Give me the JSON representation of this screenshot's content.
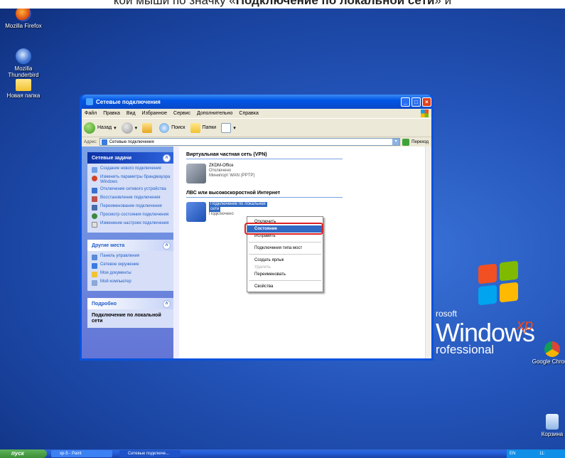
{
  "caption": {
    "before": "кой мыши по значку «",
    "bold": "Подключение по локальной сети",
    "after": "» и"
  },
  "desktop_icons": {
    "firefox": "Mozilla Firefox",
    "thunderbird": "Mozilla Thunderbird",
    "new_folder": "Новая папка",
    "chrome": "Google Chrome",
    "recycle_bin": "Корзина"
  },
  "logo": {
    "microsoft": "rosoft",
    "windows": "Windows",
    "xp": "xp",
    "professional": "rofessional"
  },
  "window": {
    "title": "Сетевые подключения",
    "menu": [
      "Файл",
      "Правка",
      "Вид",
      "Избранное",
      "Сервис",
      "Дополнительно",
      "Справка"
    ],
    "toolbar": {
      "back": "Назад",
      "search": "Поиск",
      "folders": "Папки"
    },
    "address": {
      "label": "Адрес:",
      "value": "Сетевые подключения",
      "go": "Переход"
    }
  },
  "left_pane": {
    "network_tasks": {
      "title": "Сетевые задачи",
      "items": [
        "Создание нового подключения",
        "Изменить параметры брандмауэра Windows",
        "Отключение сетевого устройства",
        "Восстановление подключения",
        "Переименование подключения",
        "Просмотр состояния подключения",
        "Изменение настроек подключения"
      ]
    },
    "other_places": {
      "title": "Другие места",
      "items": [
        "Панель управления",
        "Сетевое окружение",
        "Мои документы",
        "Мой компьютер"
      ]
    },
    "details": {
      "title": "Подробно",
      "text": "Подключение по локальной сети"
    }
  },
  "main_pane": {
    "vpn_group": "Виртуальная частная сеть (VPN)",
    "vpn_conn": {
      "name": "ZKDM-Office",
      "status": "Отключено",
      "device": "Минипорт WAN (PPTP)"
    },
    "lan_group": "ЛВС или высокоскоростной Интернет",
    "lan_conn": {
      "name_line1": "Подключение по локальной",
      "name_line2": "сети",
      "status": "Подключено"
    }
  },
  "context_menu": {
    "items": [
      "Отключить",
      "Состояние",
      "Исправить",
      "Подключения типа мост",
      "Создать ярлык",
      "Удалить",
      "Переименовать",
      "Свойства"
    ]
  },
  "taskbar": {
    "start": "пуск",
    "task1": "xp-5 - Paint",
    "task2": "Сетевые подключе...",
    "tray_lang": "EN",
    "clock": "11:"
  }
}
